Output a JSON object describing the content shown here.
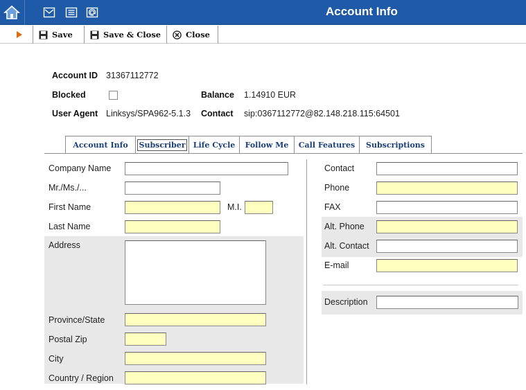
{
  "window": {
    "title": "Account Info",
    "icons": [
      "home-icon",
      "mail-icon",
      "list-icon",
      "at-icon"
    ]
  },
  "toolbar": {
    "save_label": "Save",
    "save_close_label": "Save & Close",
    "close_label": "Close"
  },
  "account": {
    "account_id_label": "Account ID",
    "account_id_value": "31367112772",
    "blocked_label": "Blocked",
    "blocked_checked": false,
    "balance_label": "Balance",
    "balance_value": "1.14910 EUR",
    "user_agent_label": "User Agent",
    "user_agent_value": "Linksys/SPA962-5.1.3",
    "contact_label": "Contact",
    "contact_value": "sip:0367112772@82.148.218.115:64501"
  },
  "tabs": [
    {
      "label": "Account Info",
      "active": false
    },
    {
      "label": "Subscriber",
      "active": true
    },
    {
      "label": "Life Cycle",
      "active": false
    },
    {
      "label": "Follow Me",
      "active": false
    },
    {
      "label": "Call Features",
      "active": false
    },
    {
      "label": "Subscriptions",
      "active": false
    }
  ],
  "form_left": {
    "company_name": {
      "label": "Company Name",
      "value": ""
    },
    "salutation": {
      "label": "Mr./Ms./...",
      "value": ""
    },
    "first_name": {
      "label": "First Name",
      "value": ""
    },
    "mi": {
      "label": "M.I.",
      "value": ""
    },
    "last_name": {
      "label": "Last Name",
      "value": ""
    },
    "address": {
      "label": "Address",
      "value": ""
    },
    "province": {
      "label": "Province/State",
      "value": ""
    },
    "postal": {
      "label": "Postal Zip",
      "value": ""
    },
    "city": {
      "label": "City",
      "value": ""
    },
    "country": {
      "label": "Country / Region",
      "value": ""
    }
  },
  "form_right": {
    "contact": {
      "label": "Contact",
      "value": ""
    },
    "phone": {
      "label": "Phone",
      "value": ""
    },
    "fax": {
      "label": "FAX",
      "value": ""
    },
    "alt_phone": {
      "label": "Alt. Phone",
      "value": ""
    },
    "alt_contact": {
      "label": "Alt. Contact",
      "value": ""
    },
    "email": {
      "label": "E-mail",
      "value": ""
    },
    "description": {
      "label": "Description",
      "value": ""
    }
  },
  "colors": {
    "titlebar": "#1f5aa8",
    "required_field": "#ffffc0",
    "tab_text": "#1a3f7a"
  }
}
